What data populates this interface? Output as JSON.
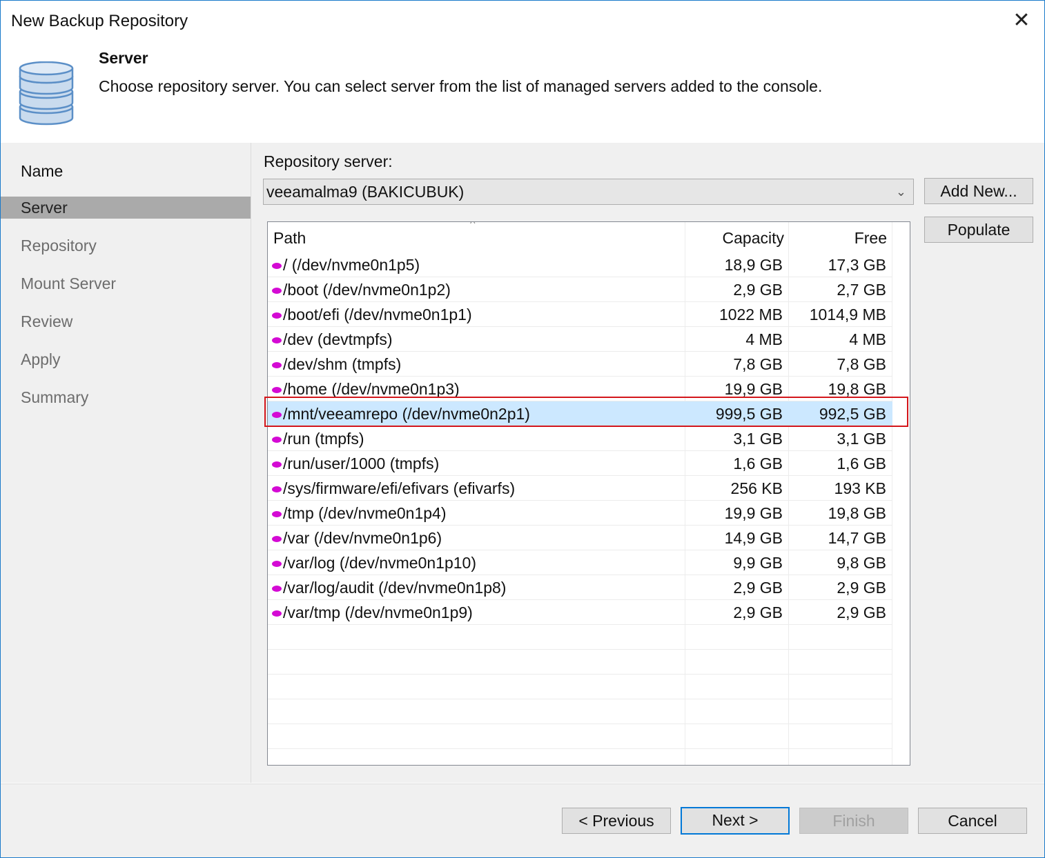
{
  "window": {
    "title": "New Backup Repository",
    "close_glyph": "✕"
  },
  "header": {
    "icon": "database-icon",
    "title": "Server",
    "description": "Choose repository server. You can select server from the list of managed servers added to the console."
  },
  "steps": [
    {
      "label": "Name",
      "active": false
    },
    {
      "label": "Server",
      "active": true
    },
    {
      "label": "Repository",
      "active": false
    },
    {
      "label": "Mount Server",
      "active": false
    },
    {
      "label": "Review",
      "active": false
    },
    {
      "label": "Apply",
      "active": false
    },
    {
      "label": "Summary",
      "active": false
    }
  ],
  "server": {
    "label": "Repository server:",
    "selected": "veeamalma9 (BAKICUBUK)",
    "add_new": "Add New...",
    "populate": "Populate"
  },
  "table": {
    "headers": {
      "path": "Path",
      "capacity": "Capacity",
      "free": "Free"
    },
    "rows": [
      {
        "path": "/ (/dev/nvme0n1p5)",
        "capacity": "18,9 GB",
        "free": "17,3 GB"
      },
      {
        "path": "/boot (/dev/nvme0n1p2)",
        "capacity": "2,9 GB",
        "free": "2,7 GB"
      },
      {
        "path": "/boot/efi (/dev/nvme0n1p1)",
        "capacity": "1022 MB",
        "free": "1014,9 MB"
      },
      {
        "path": "/dev (devtmpfs)",
        "capacity": "4 MB",
        "free": "4 MB"
      },
      {
        "path": "/dev/shm (tmpfs)",
        "capacity": "7,8 GB",
        "free": "7,8 GB"
      },
      {
        "path": "/home (/dev/nvme0n1p3)",
        "capacity": "19,9 GB",
        "free": "19,8 GB"
      },
      {
        "path": "/mnt/veeamrepo (/dev/nvme0n2p1)",
        "capacity": "999,5 GB",
        "free": "992,5 GB"
      },
      {
        "path": "/run (tmpfs)",
        "capacity": "3,1 GB",
        "free": "3,1 GB"
      },
      {
        "path": "/run/user/1000 (tmpfs)",
        "capacity": "1,6 GB",
        "free": "1,6 GB"
      },
      {
        "path": "/sys/firmware/efi/efivars (efivarfs)",
        "capacity": "256 KB",
        "free": "193 KB"
      },
      {
        "path": "/tmp (/dev/nvme0n1p4)",
        "capacity": "19,9 GB",
        "free": "19,8 GB"
      },
      {
        "path": "/var (/dev/nvme0n1p6)",
        "capacity": "14,9 GB",
        "free": "14,7 GB"
      },
      {
        "path": "/var/log (/dev/nvme0n1p10)",
        "capacity": "9,9 GB",
        "free": "9,8 GB"
      },
      {
        "path": "/var/log/audit (/dev/nvme0n1p8)",
        "capacity": "2,9 GB",
        "free": "2,9 GB"
      },
      {
        "path": "/var/tmp (/dev/nvme0n1p9)",
        "capacity": "2,9 GB",
        "free": "2,9 GB"
      }
    ],
    "selected_index": 6
  },
  "footer": {
    "previous": "< Previous",
    "next": "Next >",
    "finish": "Finish",
    "cancel": "Cancel"
  },
  "colors": {
    "accent": "#0078d7",
    "selection": "#cce8ff",
    "highlight_border": "#d3151a",
    "disk_icon": "#d40ad4"
  }
}
